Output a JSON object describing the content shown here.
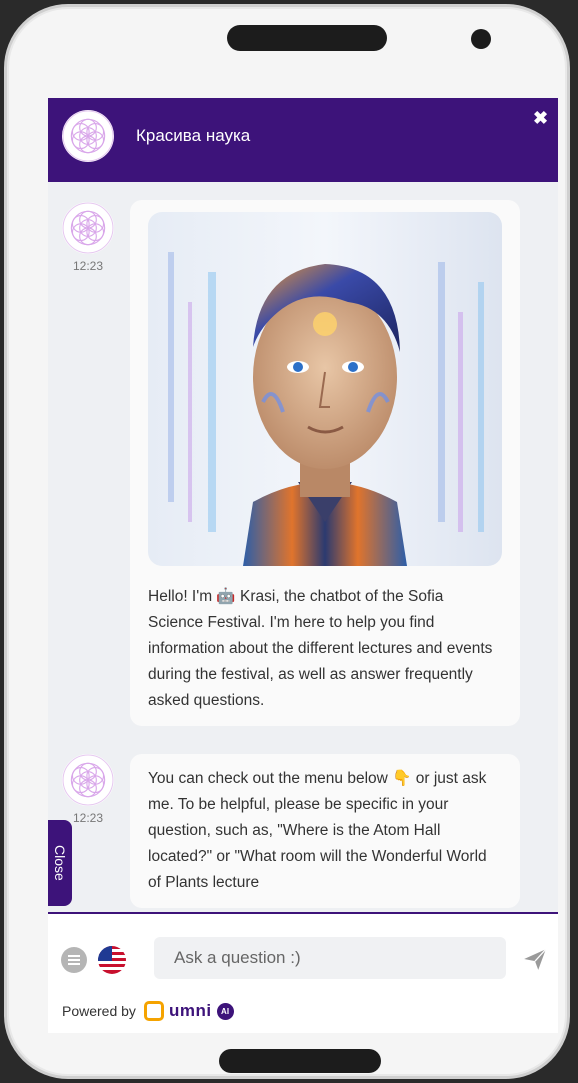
{
  "header": {
    "title": "Красива наука",
    "close_symbol": "✖"
  },
  "messages": [
    {
      "time": "12:23",
      "text_before_emoji": "Hello! I'm ",
      "emoji": "🤖",
      "text_after_emoji": " Krasi, the chatbot of the Sofia Science Festival. I'm here to help you find information about the different lectures and events during the festival, as well as answer frequently asked questions."
    },
    {
      "time": "12:23",
      "text_before_emoji": "You can check out the menu below ",
      "emoji": "👇",
      "text_after_emoji": " or just ask me. To be helpful, please be specific in your question, such as, \"Where is the Atom Hall located?\" or \"What room will the Wonderful World of Plants lecture"
    }
  ],
  "close_tab": {
    "label": "Close"
  },
  "input": {
    "placeholder": "Ask a question :)"
  },
  "footer": {
    "powered_by": "Powered by",
    "brand": "umni",
    "brand_badge": "AI"
  },
  "icons": {
    "menu": "menu-icon",
    "language": "us-flag-icon",
    "send": "send-icon",
    "avatar": "flower-of-life-icon"
  },
  "colors": {
    "brand_purple": "#3d137a",
    "chat_bg": "#eef0f3",
    "bubble_bg": "#fafafa",
    "umni_orange": "#f5a300"
  }
}
